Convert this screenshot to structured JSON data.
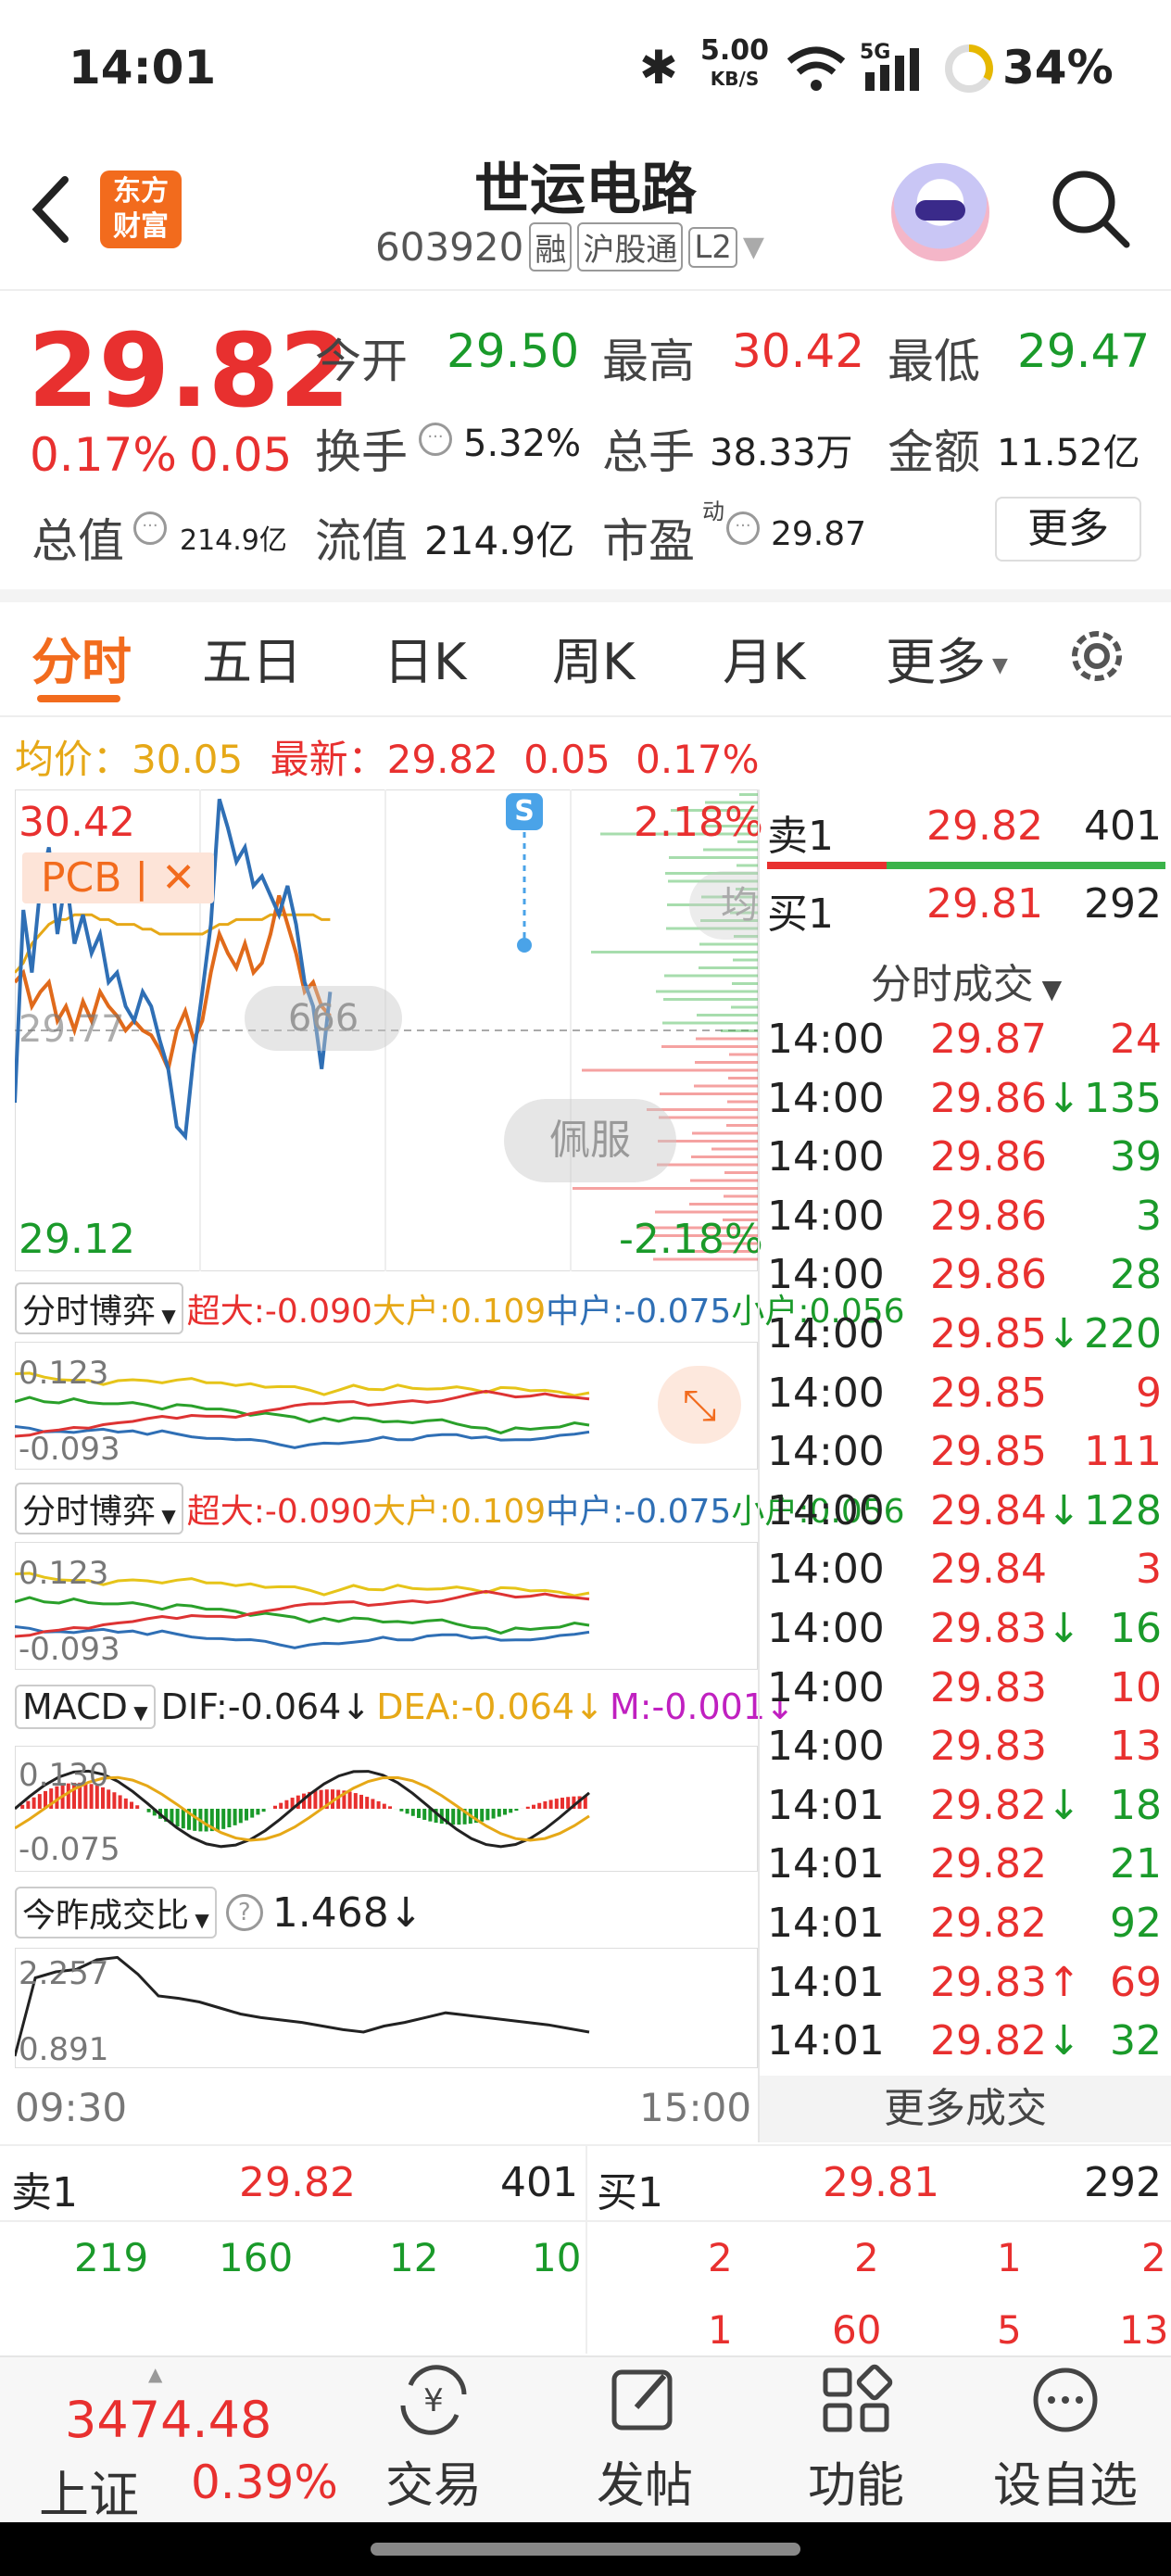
{
  "status": {
    "time": "14:01",
    "net_speed": "5.00",
    "net_unit": "KB/S",
    "signal": "5G",
    "battery": "34%"
  },
  "header": {
    "logo_line1": "东方",
    "logo_line2": "财富",
    "stock_name": "世运电路",
    "code": "603920",
    "tags": [
      "融",
      "沪股通",
      "L2"
    ]
  },
  "quote": {
    "price": "29.82",
    "change_pct": "0.17%",
    "change": "0.05",
    "open_label": "今开",
    "open": "29.50",
    "high_label": "最高",
    "high": "30.42",
    "low_label": "最低",
    "low": "29.47",
    "turnover_label": "换手",
    "turnover": "5.32%",
    "volume_label": "总手",
    "volume": "38.33万",
    "amount_label": "金额",
    "amount": "11.52亿",
    "mcap_label": "总值",
    "mcap": "214.9亿",
    "float_label": "流值",
    "float": "214.9亿",
    "pe_label": "市盈",
    "pe_sup": "动",
    "pe": "29.87",
    "more": "更多"
  },
  "tabs": [
    "分时",
    "五日",
    "日K",
    "周K",
    "月K",
    "更多"
  ],
  "info_bar": {
    "avg_label": "均价：",
    "avg": "30.05",
    "last_label": "最新：",
    "last": "29.82",
    "chg": "0.05",
    "pct": "0.17%"
  },
  "chart": {
    "y_high": "30.42",
    "y_mid": "29.77",
    "y_low": "29.12",
    "pct_high": "2.18%",
    "pct_low": "-2.18%",
    "tag": "PCB | ✕",
    "badge": "S",
    "bubble1": "666",
    "bubble2": "佩服",
    "x_start": "09:30",
    "x_end": "15:00",
    "side_char": "均"
  },
  "ind1": {
    "name": "分时博弈",
    "items": [
      "超大:-0.090",
      "大户:0.109",
      "中户:-0.075",
      "小户:0.056"
    ],
    "ymax": "0.123",
    "ymin": "-0.093"
  },
  "ind2": {
    "name": "分时博弈",
    "items": [
      "超大:-0.090",
      "大户:0.109",
      "中户:-0.075",
      "小户:0.056"
    ],
    "ymax": "0.123",
    "ymin": "-0.093"
  },
  "macd": {
    "name": "MACD",
    "dif": "DIF:-0.064↓",
    "dea": "DEA:-0.064↓",
    "m": "M:-0.001↓",
    "ymax": "0.130",
    "ymin": "-0.075"
  },
  "vol_ratio": {
    "name": "今昨成交比",
    "value": "1.468↓",
    "ymax": "2.257",
    "ymin": "0.891"
  },
  "orderbook": {
    "sell_label": "卖1",
    "sell_price": "29.82",
    "sell_qty": "401",
    "buy_label": "买1",
    "buy_price": "29.81",
    "buy_qty": "292"
  },
  "trades_title": "分时成交",
  "trades": [
    {
      "t": "14:00",
      "p": "29.87",
      "arrow": "",
      "v": "24",
      "c": "r"
    },
    {
      "t": "14:00",
      "p": "29.86",
      "arrow": "↓",
      "v": "135",
      "c": "g"
    },
    {
      "t": "14:00",
      "p": "29.86",
      "arrow": "",
      "v": "39",
      "c": "g"
    },
    {
      "t": "14:00",
      "p": "29.86",
      "arrow": "",
      "v": "3",
      "c": "g"
    },
    {
      "t": "14:00",
      "p": "29.86",
      "arrow": "",
      "v": "28",
      "c": "g"
    },
    {
      "t": "14:00",
      "p": "29.85",
      "arrow": "↓",
      "v": "220",
      "c": "g"
    },
    {
      "t": "14:00",
      "p": "29.85",
      "arrow": "",
      "v": "9",
      "c": "r"
    },
    {
      "t": "14:00",
      "p": "29.85",
      "arrow": "",
      "v": "111",
      "c": "r"
    },
    {
      "t": "14:00",
      "p": "29.84",
      "arrow": "↓",
      "v": "128",
      "c": "g"
    },
    {
      "t": "14:00",
      "p": "29.84",
      "arrow": "",
      "v": "3",
      "c": "r"
    },
    {
      "t": "14:00",
      "p": "29.83",
      "arrow": "↓",
      "v": "16",
      "c": "g"
    },
    {
      "t": "14:00",
      "p": "29.83",
      "arrow": "",
      "v": "10",
      "c": "r"
    },
    {
      "t": "14:00",
      "p": "29.83",
      "arrow": "",
      "v": "13",
      "c": "r"
    },
    {
      "t": "14:01",
      "p": "29.82",
      "arrow": "↓",
      "v": "18",
      "c": "g"
    },
    {
      "t": "14:01",
      "p": "29.82",
      "arrow": "",
      "v": "21",
      "c": "g"
    },
    {
      "t": "14:01",
      "p": "29.82",
      "arrow": "",
      "v": "92",
      "c": "g"
    },
    {
      "t": "14:01",
      "p": "29.83",
      "arrow": "↑",
      "v": "69",
      "c": "r"
    },
    {
      "t": "14:01",
      "p": "29.82",
      "arrow": "↓",
      "v": "32",
      "c": "g"
    }
  ],
  "more_trades": "更多成交",
  "bottom_book": {
    "sell_label": "卖1",
    "sell_price": "29.82",
    "sell_qty": "401",
    "buy_label": "买1",
    "buy_price": "29.81",
    "buy_qty": "292",
    "sell_row": [
      "219",
      "160",
      "12",
      "10"
    ],
    "buy_row1": [
      "2",
      "2",
      "1",
      "2"
    ],
    "buy_row2": [
      "1",
      "60",
      "5",
      "13"
    ]
  },
  "nav": {
    "index_value": "3474.48",
    "index_name": "上证",
    "index_pct": "0.39%",
    "items": [
      "交易",
      "发帖",
      "功能",
      "设自选"
    ]
  },
  "colors": {
    "up": "#e8302f",
    "down": "#1a9a2a",
    "accent": "#f26b1d",
    "price_line": "#2f6fb5",
    "avg_line": "#e6a817",
    "stock_line": "#e06a1b"
  }
}
